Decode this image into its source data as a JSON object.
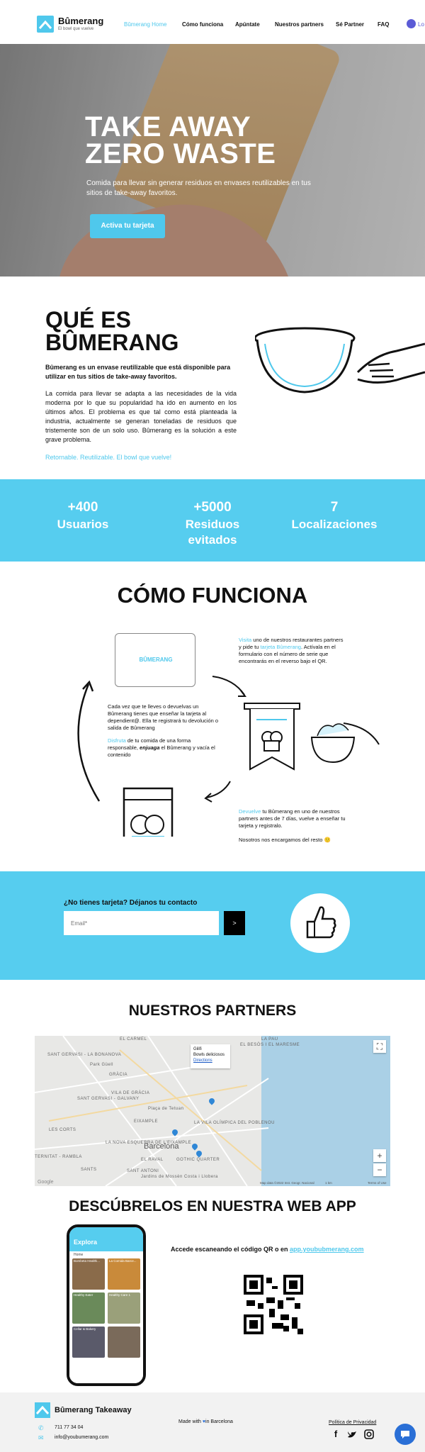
{
  "header": {
    "brand": "Bûmerang",
    "tagline": "El bowl que vuelve",
    "nav": [
      "Bûmerang Home",
      "Cómo funciona",
      "Apúntate",
      "Nuestros partners",
      "Sé Partner",
      "FAQ"
    ],
    "login": "Lo"
  },
  "hero": {
    "title_line1": "TAKE AWAY",
    "title_line2": "ZERO WASTE",
    "subtitle": "Comida para llevar sin generar residuos en envases reutilizables en tus sitios de take-away favoritos.",
    "cta": "Activa tu tarjeta"
  },
  "que_es": {
    "title_line1": "QUÉ ES",
    "title_line2": "BÛMERANG",
    "lead_bold": "Bûmerang",
    "lead_rest": " es un envase reutilizable que está disponible para utilizar en tus sitios de take-away favoritos.",
    "body": "La comida para llevar se adapta a las necesidades de la vida moderna por lo que su popularidad ha ido en aumento en los últimos años. El problema es que tal como está planteada la industria, actualmente se generan toneladas de residuos que tristemente son de un solo uso. Bûmerang es la solución a este grave problema.",
    "tagline": "Retornable. Reutilizable. El bowl que vuelve!"
  },
  "stats": [
    {
      "number": "+400",
      "label_line1": "Usuarios",
      "label_line2": ""
    },
    {
      "number": "+5000",
      "label_line1": "Residuos",
      "label_line2": "evitados"
    },
    {
      "number": "7",
      "label_line1": "Localizaciones",
      "label_line2": ""
    }
  ],
  "como": {
    "title": "CÓMO FUNCIONA",
    "card_brand": "BÛMERANG",
    "step1_hl": "Visita",
    "step1_a": " uno de nuestros restaurantes partners y pide tu ",
    "step1_hl2": "tarjeta Bûmerang",
    "step1_b": ". Actívala en el formulario con el número de serie que encontrarás en el reverso bajo el QR.",
    "step2": "Cada vez que te lleves o devuelvas un Bûmerang tienes que enseñar la tarjeta al dependient@. Ella te registrará tu devolución o salida de Bûmerang",
    "step3_hl": "Disfruta",
    "step3_a": " de tu comida de una forma responsable, ",
    "step3_bold": "enjuaga",
    "step3_b": " el Bûmerang y vacía el contenido",
    "step4_hl": "Devuelve",
    "step4_a": " tu Bûmerang en uno de nuestros partners antes de 7 días, vuelve a enseñar tu tarjeta y registralo.",
    "step5": "Nosotros nos encargamos del resto 🙂"
  },
  "contact": {
    "title": "¿No tienes tarjeta? Déjanos tu contacto",
    "email_placeholder": "Email*",
    "submit": ">"
  },
  "partners": {
    "title": "NUESTROS PARTNERS",
    "popup_name": "Gilifi",
    "popup_desc": "Bowls deliciosos",
    "popup_link": "Directions",
    "city": "Barcelona",
    "labels": [
      "EL CARMEL",
      "SANT GERVASI - LA BONANOVA",
      "GRÀCIA",
      "SANT GERVASI - GALVANY",
      "VILA DE GRÀCIA",
      "LES CORTS",
      "EIXAMPLE",
      "LA NOVA ESQUERRA DE L'EIXAMPLE",
      "EL RAVAL",
      "SANT ANTONI",
      "GOTHIC QUARTER",
      "LA VILA OLÍMPICA DEL POBLENOU",
      "EL BESÒS I EL MARESME",
      "LA PAU",
      "Plaça de Tetuan",
      "Park Güell",
      "SANTS",
      "TERNITAT - RAMBLA",
      "Jardins de Mossèn Costa i Llobera"
    ],
    "map_footer": "Map data ©2022 Inst. Geogr. Nacional",
    "map_scale": "1 km",
    "map_terms": "Terms of Use",
    "google": "Google"
  },
  "webapp": {
    "title": "DESCÚBRELOS EN NUESTRA WEB APP",
    "text": "Accede escaneando el código QR o en ",
    "link": "app.yoububmerang.com",
    "phone_title": "Explora",
    "phone_home": "Home",
    "tiles": [
      "Bombeta Healthi...",
      "La Comida Barce...",
      "Healthy Eater",
      "Healthy Care 1",
      "Cellar & Bakery",
      ""
    ]
  },
  "footer": {
    "brand": "Bûmerang Takeaway",
    "phone": "711 77 34 04",
    "email": "info@youbumerang.com",
    "made_prefix": "Made with",
    "made_suffix": "in Barcelona",
    "privacy": "Política de Privacidad"
  },
  "colors": {
    "accent": "#4fc8ec",
    "stats_bg": "#56cdef",
    "chat": "#2a6fd6"
  }
}
